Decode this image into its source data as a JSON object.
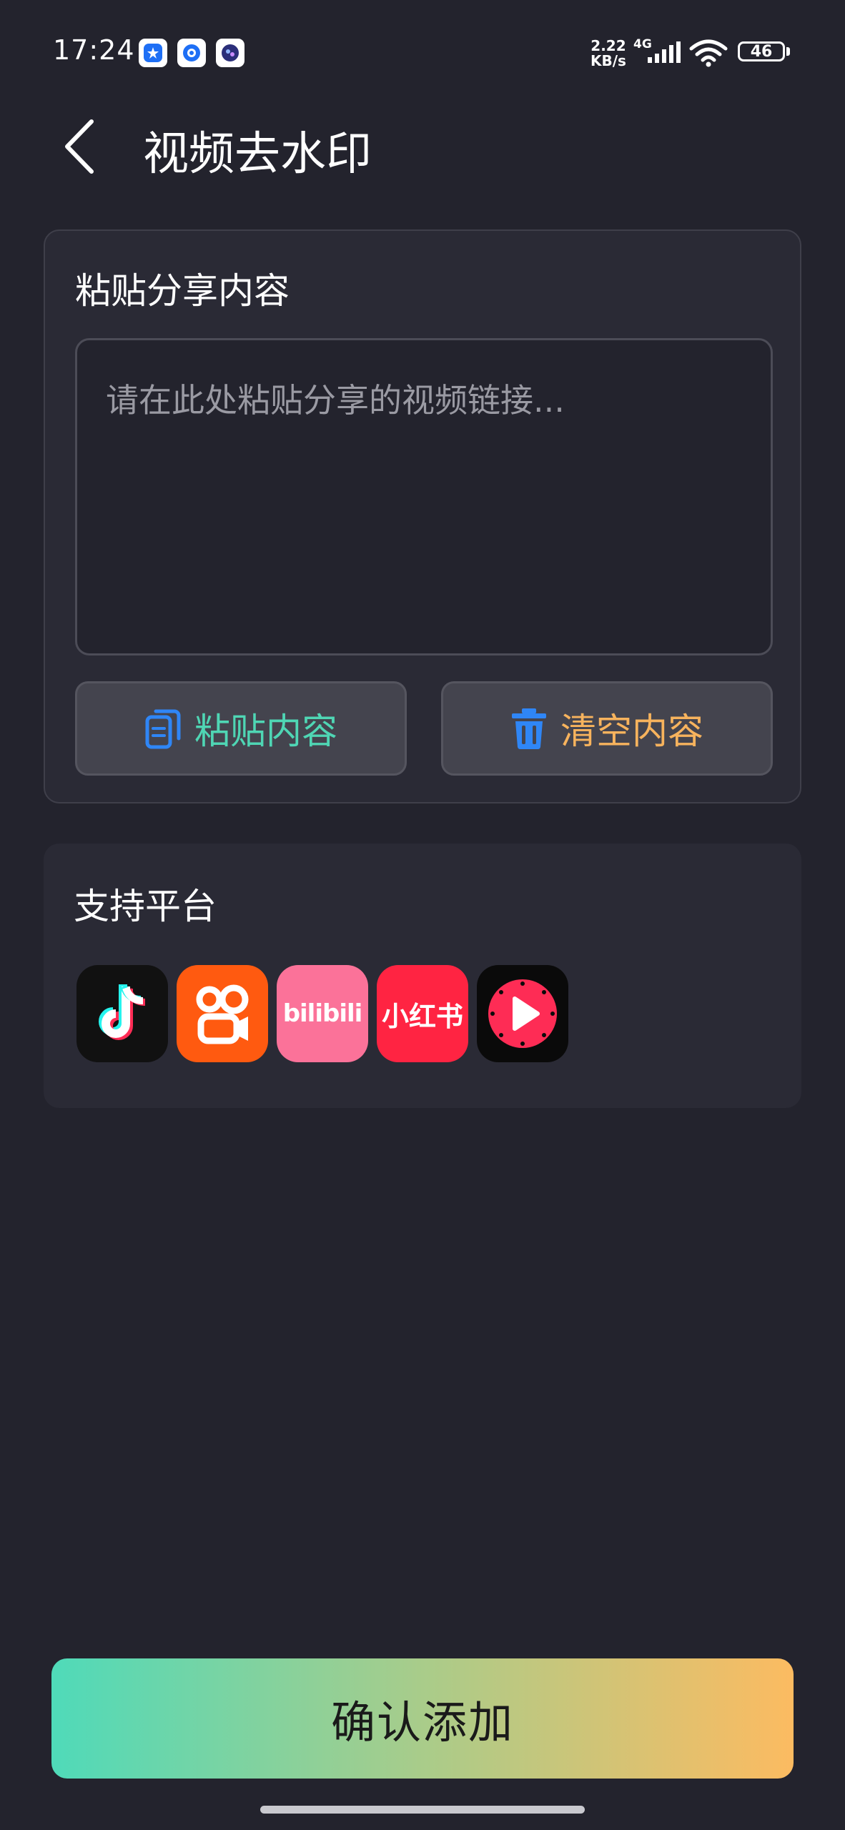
{
  "status_bar": {
    "time": "17:24",
    "net_speed_value": "2.22",
    "net_speed_unit": "KB/s",
    "network_type": "4G",
    "battery": "46",
    "notification_icons": [
      "app-notification-icon-1",
      "app-notification-icon-2",
      "app-notification-icon-3"
    ]
  },
  "header": {
    "title": "视频去水印"
  },
  "paste_card": {
    "title": "粘贴分享内容",
    "input_placeholder": "请在此处粘贴分享的视频链接...",
    "input_value": "",
    "paste_button_label": "粘贴内容",
    "clear_button_label": "清空内容"
  },
  "platforms": {
    "title": "支持平台",
    "items": [
      {
        "name": "douyin",
        "icon": "douyin-icon"
      },
      {
        "name": "kuaishou",
        "icon": "kuaishou-icon"
      },
      {
        "name": "bilibili",
        "icon": "bilibili-icon",
        "text": "bilibili"
      },
      {
        "name": "xiaohongshu",
        "icon": "xiaohongshu-icon",
        "text": "小红书"
      },
      {
        "name": "xigua",
        "icon": "xigua-icon"
      }
    ]
  },
  "confirm": {
    "label": "确认添加"
  },
  "colors": {
    "background": "#23232d",
    "card": "#2a2a35",
    "paste_accent": "#4fd6b4",
    "clear_accent": "#f7b35d",
    "icon_blue": "#2f86f6",
    "gradient_start": "#4fdab9",
    "gradient_end": "#fcbb61"
  }
}
